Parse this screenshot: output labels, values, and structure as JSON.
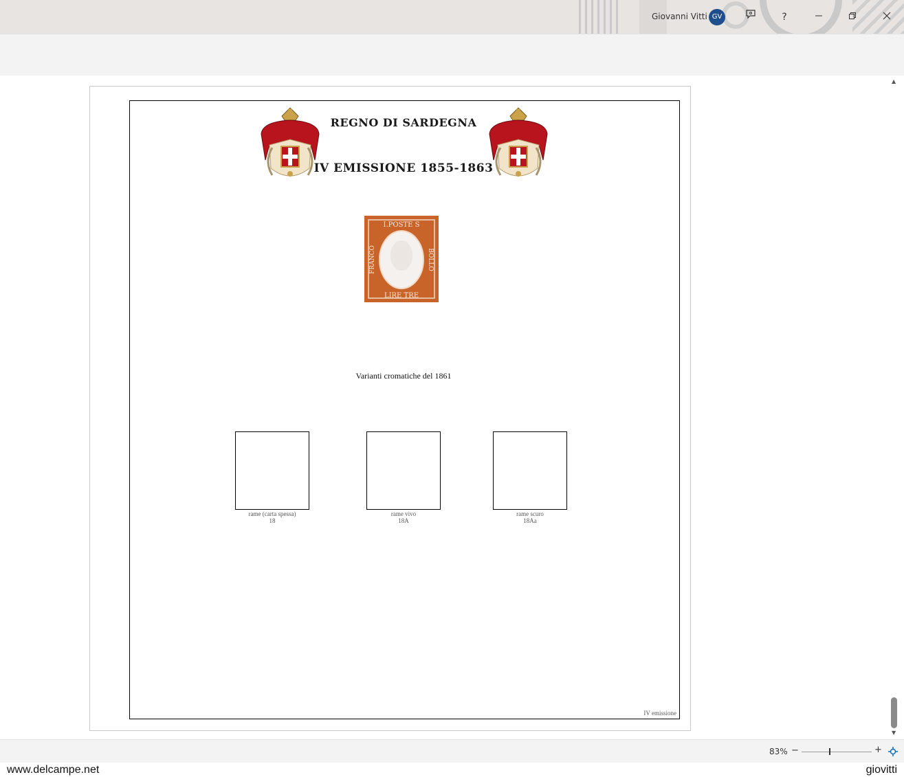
{
  "titlebar": {
    "user_name": "Giovanni Vitti",
    "avatar_initials": "GV",
    "icons": [
      "feedback-icon",
      "help-icon",
      "minimize-icon",
      "restore-icon",
      "close-icon"
    ],
    "help_glyph": "?",
    "minimize_glyph": "—",
    "restore_glyph": "❐",
    "close_glyph": "✕"
  },
  "document": {
    "title_line1": "REGNO DI SARDEGNA",
    "title_line2": "IV EMISSIONE 1855-1863",
    "stamp": {
      "top_text": "I.POSTE S",
      "left_text": "FRANCO",
      "right_text": "BOLLO",
      "bottom_text": "LIRE TRE",
      "color": "#c8642a"
    },
    "section_title": "Varianti cromatiche del 1861",
    "slots": [
      {
        "name": "rame (carta spessa)",
        "code": "18"
      },
      {
        "name": "rame vivo",
        "code": "18A"
      },
      {
        "name": "rame scuro",
        "code": "18Aa"
      }
    ],
    "footer_note": "IV emissione"
  },
  "statusbar": {
    "zoom": "83%",
    "zoom_minus": "−",
    "zoom_plus": "+"
  },
  "watermark": {
    "left": "www.delcampe.net",
    "right": "giovitti"
  },
  "colors": {
    "accent_avatar": "#1f4e8c",
    "stamp_orange": "#c8642a",
    "coat_red": "#b8141e"
  }
}
